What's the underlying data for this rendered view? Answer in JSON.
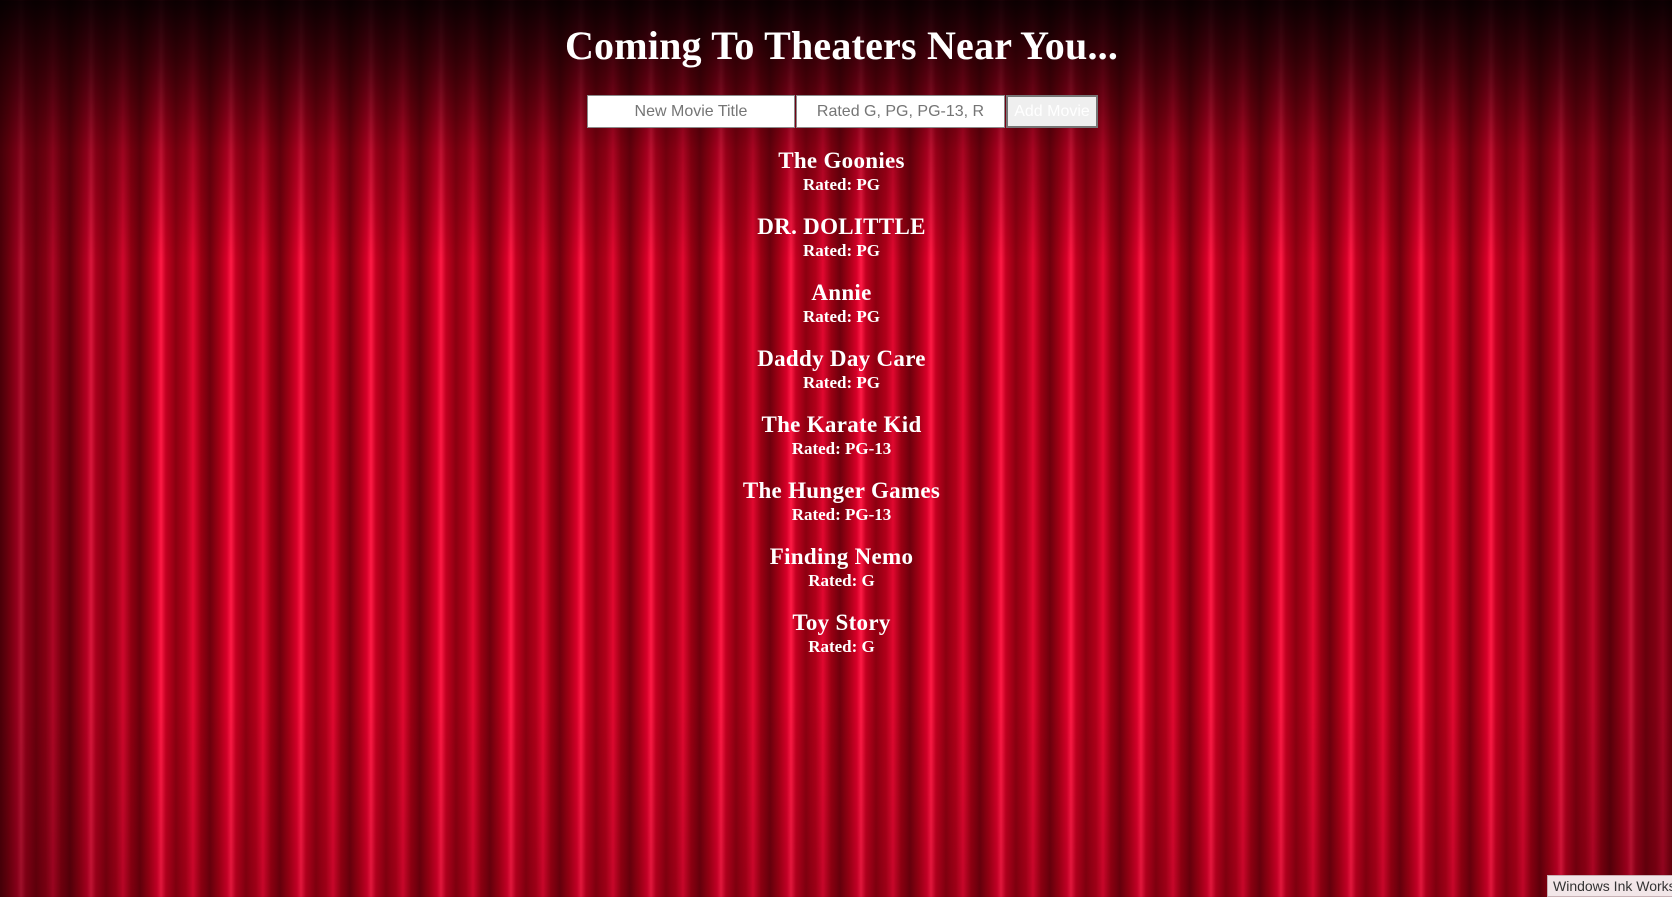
{
  "page": {
    "heading": "Coming To Theaters Near You..."
  },
  "form": {
    "title_placeholder": "New Movie Title",
    "rating_placeholder": "Rated G, PG, PG-13, R",
    "add_label": "Add Movie"
  },
  "movies": [
    {
      "title": "The Goonies",
      "rating": "Rated: PG"
    },
    {
      "title": "DR. DOLITTLE",
      "rating": "Rated: PG"
    },
    {
      "title": "Annie",
      "rating": "Rated: PG"
    },
    {
      "title": "Daddy Day Care",
      "rating": "Rated: PG"
    },
    {
      "title": "The Karate Kid",
      "rating": "Rated: PG-13"
    },
    {
      "title": "The Hunger Games",
      "rating": "Rated: PG-13"
    },
    {
      "title": "Finding Nemo",
      "rating": "Rated: G"
    },
    {
      "title": "Toy Story",
      "rating": "Rated: G"
    }
  ],
  "system": {
    "ink_tooltip": "Windows Ink Workspace"
  }
}
